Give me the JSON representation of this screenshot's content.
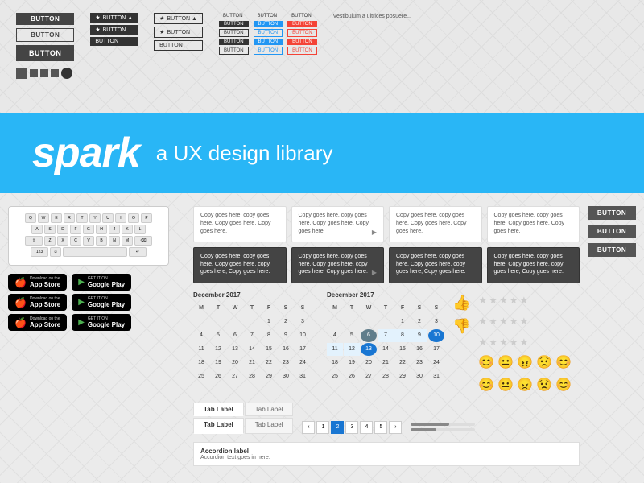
{
  "page": {
    "title": "Spark - a UX design library"
  },
  "hero": {
    "spark_label": "spark",
    "subtitle": "a UX design library"
  },
  "top_buttons": {
    "btn1": "BUTTON",
    "btn2": "BUTTON",
    "btn3": "BUTTON"
  },
  "bottom": {
    "keyboard": {
      "rows": [
        [
          "Q",
          "W",
          "E",
          "R",
          "T",
          "Y",
          "U",
          "I",
          "O",
          "P"
        ],
        [
          "A",
          "S",
          "D",
          "F",
          "G",
          "H",
          "J",
          "K",
          "L"
        ],
        [
          "Z",
          "X",
          "C",
          "V",
          "B",
          "N",
          "M"
        ]
      ]
    },
    "app_store_badges": [
      {
        "top": "Download on the",
        "main": "App Store",
        "icon": ""
      },
      {
        "top": "GET IT ON",
        "main": "Google Play",
        "icon": "▶"
      },
      {
        "top": "Download on the",
        "main": "App Store",
        "icon": ""
      },
      {
        "top": "GET IT ON",
        "main": "Google Play",
        "icon": "▶"
      },
      {
        "top": "Download on the",
        "main": "App Store",
        "icon": ""
      },
      {
        "top": "GET IT ON",
        "main": "Google Play",
        "icon": "▶"
      }
    ],
    "cards": [
      {
        "text": "Copy goes here, copy goes here, Copy goes here, Copy goes here."
      },
      {
        "text": "Copy goes here, copy goes here, Copy goes here, Copy goes here."
      },
      {
        "text": "Copy goes here, copy goes here, Copy goes here, Copy goes here."
      },
      {
        "text": "Copy goes here, copy goes here, Copy goes here, Copy goes here."
      }
    ],
    "dark_cards": [
      {
        "text": "Copy goes here, copy goes here, Copy goes here, copy goes here, Copy goes here."
      },
      {
        "text": "Copy goes here, copy goes here, Copy goes here, copy goes here, Copy goes here."
      },
      {
        "text": "Copy goes here, copy goes here, Copy goes here, copy goes here, Copy goes here."
      },
      {
        "text": "Copy goes here, copy goes here, Copy goes here, copy goes here, Copy goes here."
      }
    ],
    "calendar": {
      "month1": "December 2017",
      "month2": "December 2017",
      "days_header": [
        "M",
        "T",
        "W",
        "T",
        "F",
        "S",
        "S"
      ],
      "week1": [
        "",
        "",
        "",
        "1",
        "2",
        "3"
      ],
      "week2": [
        "4",
        "5",
        "6",
        "7",
        "8",
        "9",
        "10"
      ],
      "week3": [
        "11",
        "12",
        "13",
        "14",
        "15",
        "16",
        "17"
      ],
      "week4": [
        "18",
        "19",
        "20",
        "21",
        "22",
        "23",
        "24"
      ],
      "week5": [
        "25",
        "26",
        "27",
        "28",
        "29",
        "30",
        "31"
      ]
    },
    "tabs": [
      {
        "label": "Tab Label",
        "active": false
      },
      {
        "label": "Tab Label",
        "active": false
      },
      {
        "label": "Tab Label",
        "active": false
      },
      {
        "label": "Tab Label",
        "active": false
      }
    ],
    "accordion": {
      "label": "Accordion label",
      "text": "Accordion text goes in here."
    },
    "pagination": [
      "‹",
      "1",
      "2",
      "3",
      "4",
      "5",
      "›"
    ],
    "right_buttons": [
      "BUTTON",
      "BUTTON",
      "BUTTON"
    ],
    "emojis": [
      "😊",
      "😐",
      "😠",
      "😟",
      "😊"
    ]
  }
}
